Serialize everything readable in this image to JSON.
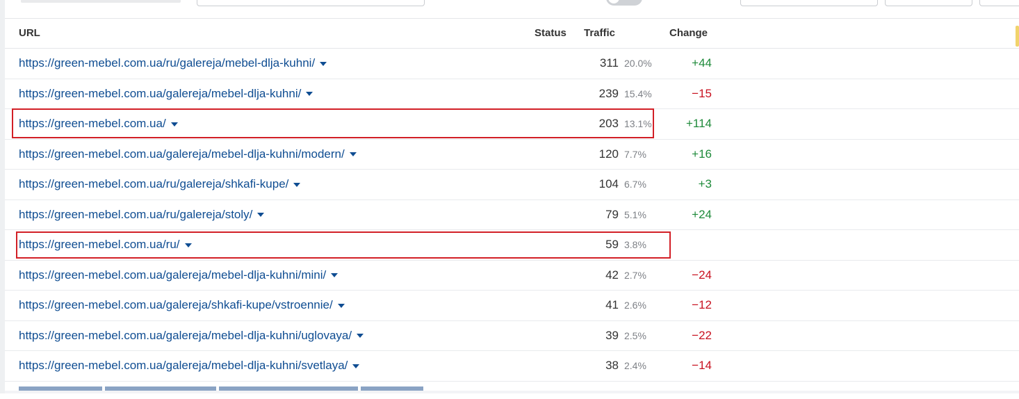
{
  "table": {
    "columns": {
      "url": "URL",
      "status": "Status",
      "traffic": "Traffic",
      "change": "Change"
    },
    "rows": [
      {
        "url": "https://green-mebel.com.ua/ru/galereja/mebel-dlja-kuhni/",
        "traffic": "311",
        "percent": "20.0%",
        "change": "+44",
        "change_sign": "positive",
        "highlighted": false
      },
      {
        "url": "https://green-mebel.com.ua/galereja/mebel-dlja-kuhni/",
        "traffic": "239",
        "percent": "15.4%",
        "change": "−15",
        "change_sign": "negative",
        "highlighted": false
      },
      {
        "url": "https://green-mebel.com.ua/",
        "traffic": "203",
        "percent": "13.1%",
        "change": "+114",
        "change_sign": "positive",
        "highlighted": true
      },
      {
        "url": "https://green-mebel.com.ua/galereja/mebel-dlja-kuhni/modern/",
        "traffic": "120",
        "percent": "7.7%",
        "change": "+16",
        "change_sign": "positive",
        "highlighted": false
      },
      {
        "url": "https://green-mebel.com.ua/ru/galereja/shkafi-kupe/",
        "traffic": "104",
        "percent": "6.7%",
        "change": "+3",
        "change_sign": "positive",
        "highlighted": false
      },
      {
        "url": "https://green-mebel.com.ua/ru/galereja/stoly/",
        "traffic": "79",
        "percent": "5.1%",
        "change": "+24",
        "change_sign": "positive",
        "highlighted": false
      },
      {
        "url": "https://green-mebel.com.ua/ru/",
        "traffic": "59",
        "percent": "3.8%",
        "change": "",
        "change_sign": "none",
        "highlighted": true
      },
      {
        "url": "https://green-mebel.com.ua/galereja/mebel-dlja-kuhni/mini/",
        "traffic": "42",
        "percent": "2.7%",
        "change": "−24",
        "change_sign": "negative",
        "highlighted": false
      },
      {
        "url": "https://green-mebel.com.ua/galereja/shkafi-kupe/vstroennie/",
        "traffic": "41",
        "percent": "2.6%",
        "change": "−12",
        "change_sign": "negative",
        "highlighted": false
      },
      {
        "url": "https://green-mebel.com.ua/galereja/mebel-dlja-kuhni/uglovaya/",
        "traffic": "39",
        "percent": "2.5%",
        "change": "−22",
        "change_sign": "negative",
        "highlighted": false
      },
      {
        "url": "https://green-mebel.com.ua/galereja/mebel-dlja-kuhni/svetlaya/",
        "traffic": "38",
        "percent": "2.4%",
        "change": "−14",
        "change_sign": "negative",
        "highlighted": false
      }
    ]
  },
  "icons": {
    "row_menu": "chevron-down-icon"
  },
  "colors": {
    "link": "#0f4d92",
    "positive": "#1e8a3a",
    "negative": "#c8111f",
    "highlight": "#d21f26"
  }
}
